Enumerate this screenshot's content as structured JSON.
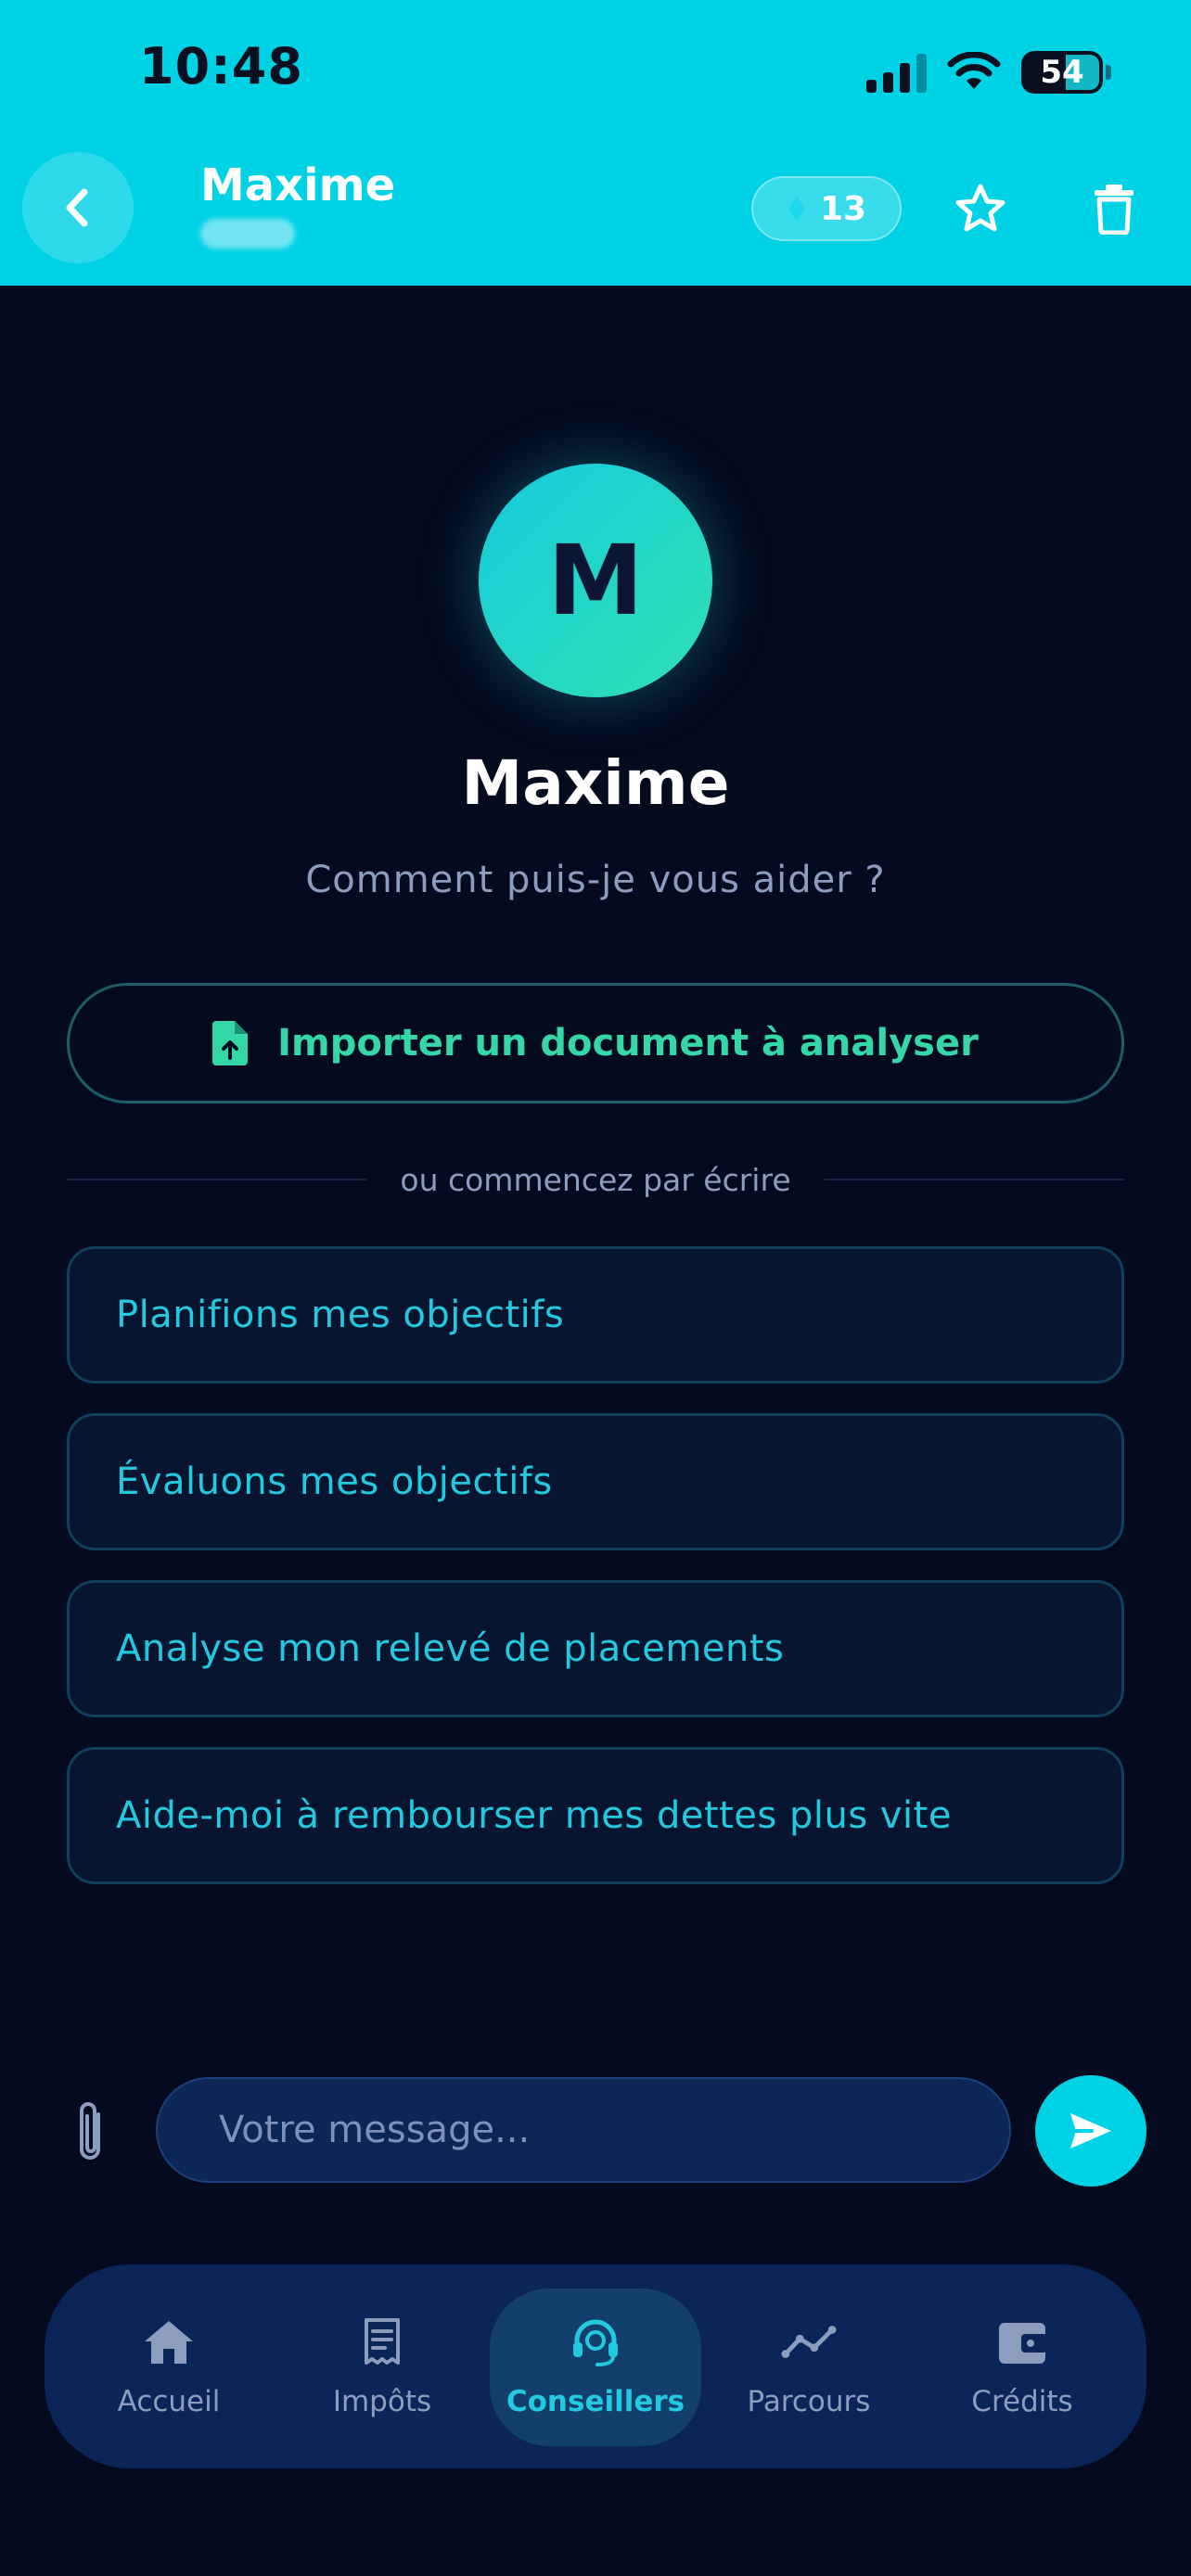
{
  "status_bar": {
    "time": "10:48",
    "battery": "54"
  },
  "header": {
    "title": "Maxime",
    "credits": "13"
  },
  "hero": {
    "initial": "M",
    "name": "Maxime",
    "subtitle": "Comment puis-je vous aider ?"
  },
  "import": {
    "label": "Importer un document à analyser"
  },
  "divider": {
    "label": "ou commencez par écrire"
  },
  "suggestions": [
    "Planifions mes objectifs",
    "Évaluons mes objectifs",
    "Analyse mon relevé de placements",
    "Aide-moi à rembourser mes dettes plus vite"
  ],
  "composer": {
    "placeholder": "Votre message..."
  },
  "nav": {
    "items": [
      {
        "label": "Accueil",
        "icon": "home-icon"
      },
      {
        "label": "Impôts",
        "icon": "receipt-icon"
      },
      {
        "label": "Conseillers",
        "icon": "headset-icon",
        "active": true
      },
      {
        "label": "Parcours",
        "icon": "trend-icon"
      },
      {
        "label": "Crédits",
        "icon": "wallet-icon"
      }
    ]
  },
  "colors": {
    "accent": "#00d2e6",
    "background": "#050b1f",
    "green": "#35d6a8",
    "nav_background": "#0c2558"
  }
}
